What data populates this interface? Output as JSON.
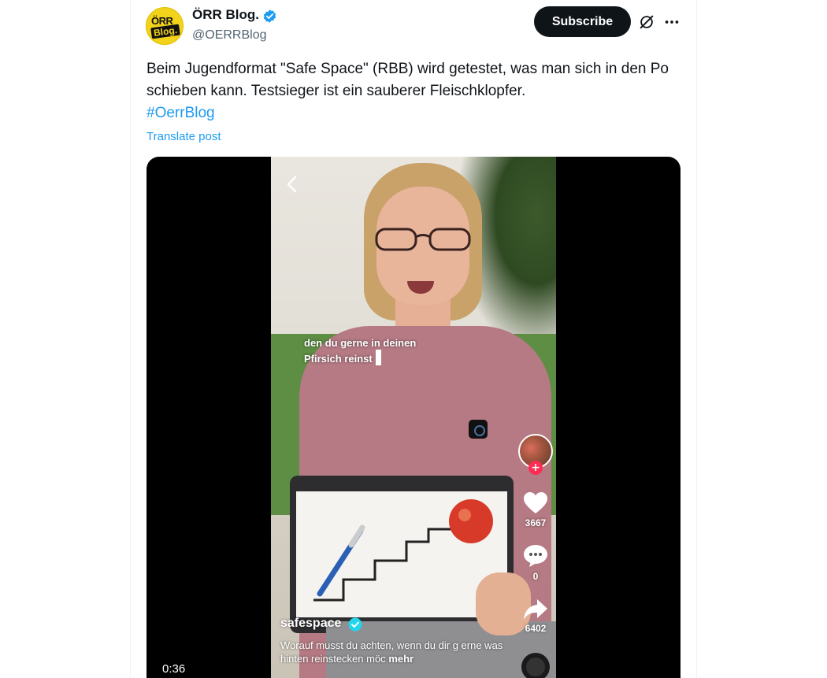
{
  "author": {
    "avatar_line1": "ÖRR",
    "avatar_line2": "Blog.",
    "display_name": "ÖRR Blog.",
    "handle": "@OERRBlog",
    "verified_icon": "verified-badge-icon"
  },
  "header": {
    "subscribe_label": "Subscribe",
    "grok_icon": "grok-icon",
    "more_icon": "more-icon"
  },
  "post": {
    "text": "Beim Jugendformat \"Safe Space\" (RBB) wird getestet, was man sich in den Po schieben kann. Testsieger ist ein sauberer Fleischklopfer.",
    "hashtag": "#OerrBlog",
    "translate_label": "Translate post"
  },
  "video": {
    "duration": "0:36",
    "caption_line1": "den du gerne in deinen",
    "caption_line2": "Pfirsich reinst",
    "tiktok": {
      "likes": "3667",
      "comments": "0",
      "shares": "6402",
      "username": "safespace",
      "description": "Worauf musst du achten, wenn du dir g erne was hinten reinstecken möc",
      "more_label": "mehr",
      "follow_symbol": "+"
    }
  },
  "colors": {
    "link": "#1d9bf0",
    "text_primary": "#0f1419",
    "text_secondary": "#536471",
    "subscribe_bg": "#0f1419",
    "tiktok_red": "#fe2c55"
  }
}
